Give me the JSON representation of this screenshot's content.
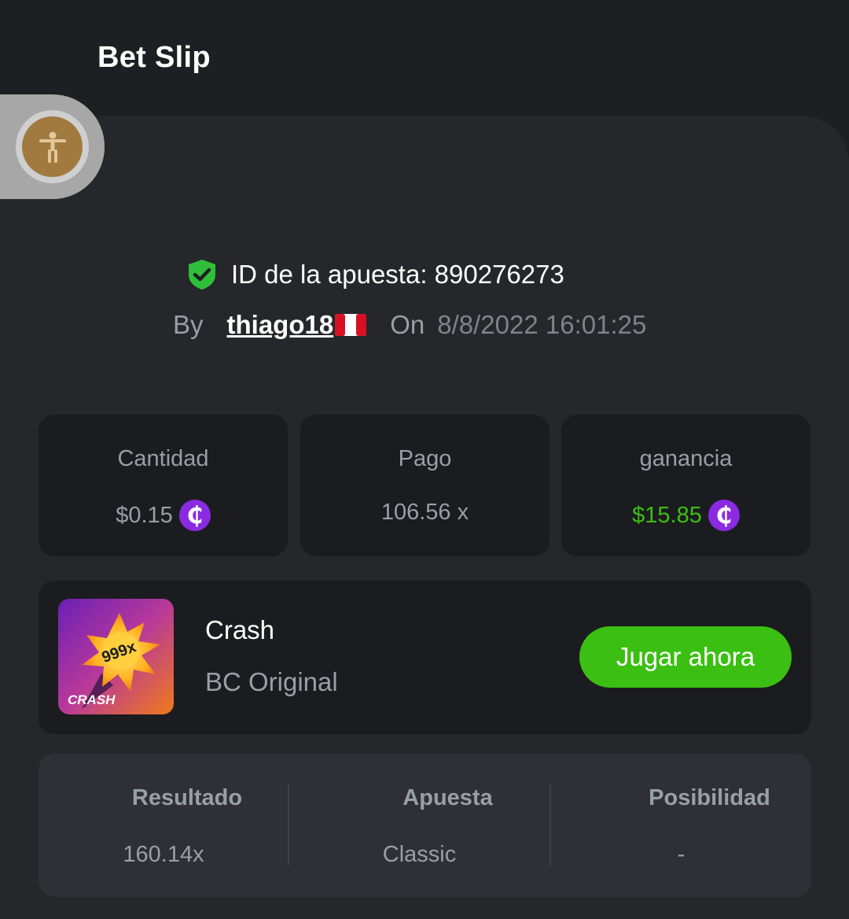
{
  "header": {
    "title": "Bet Slip"
  },
  "bet": {
    "id_label": "ID de la apuesta: 890276273",
    "by_label": "By",
    "user": "thiago18",
    "on_label": "On",
    "date": "8/8/2022 16:01:25"
  },
  "stats": [
    {
      "label": "Cantidad",
      "value": "$0.15",
      "coin": true,
      "color": "#9a9ea6"
    },
    {
      "label": "Pago",
      "value": "106.56 x",
      "coin": false,
      "color": "#9a9ea6"
    },
    {
      "label": "ganancia",
      "value": "$15.85",
      "coin": true,
      "color": "#3bbf12"
    }
  ],
  "coin_symbol": "₵",
  "game": {
    "title": "Crash",
    "subtitle": "BC Original",
    "thumb_multiplier": "999x",
    "thumb_label": "CRASH",
    "play_label": "Jugar ahora"
  },
  "results": {
    "headers": [
      "Resultado",
      "Apuesta",
      "Posibilidad"
    ],
    "values": [
      "160.14x",
      "Classic",
      "-"
    ]
  },
  "colors": {
    "accent_green": "#3bbf12",
    "shield_green": "#2fbf3a",
    "coin_purple": "#8a2be2"
  },
  "icons": [
    "accessibility-icon",
    "shield-check-icon",
    "peru-flag-icon",
    "coin-icon"
  ]
}
